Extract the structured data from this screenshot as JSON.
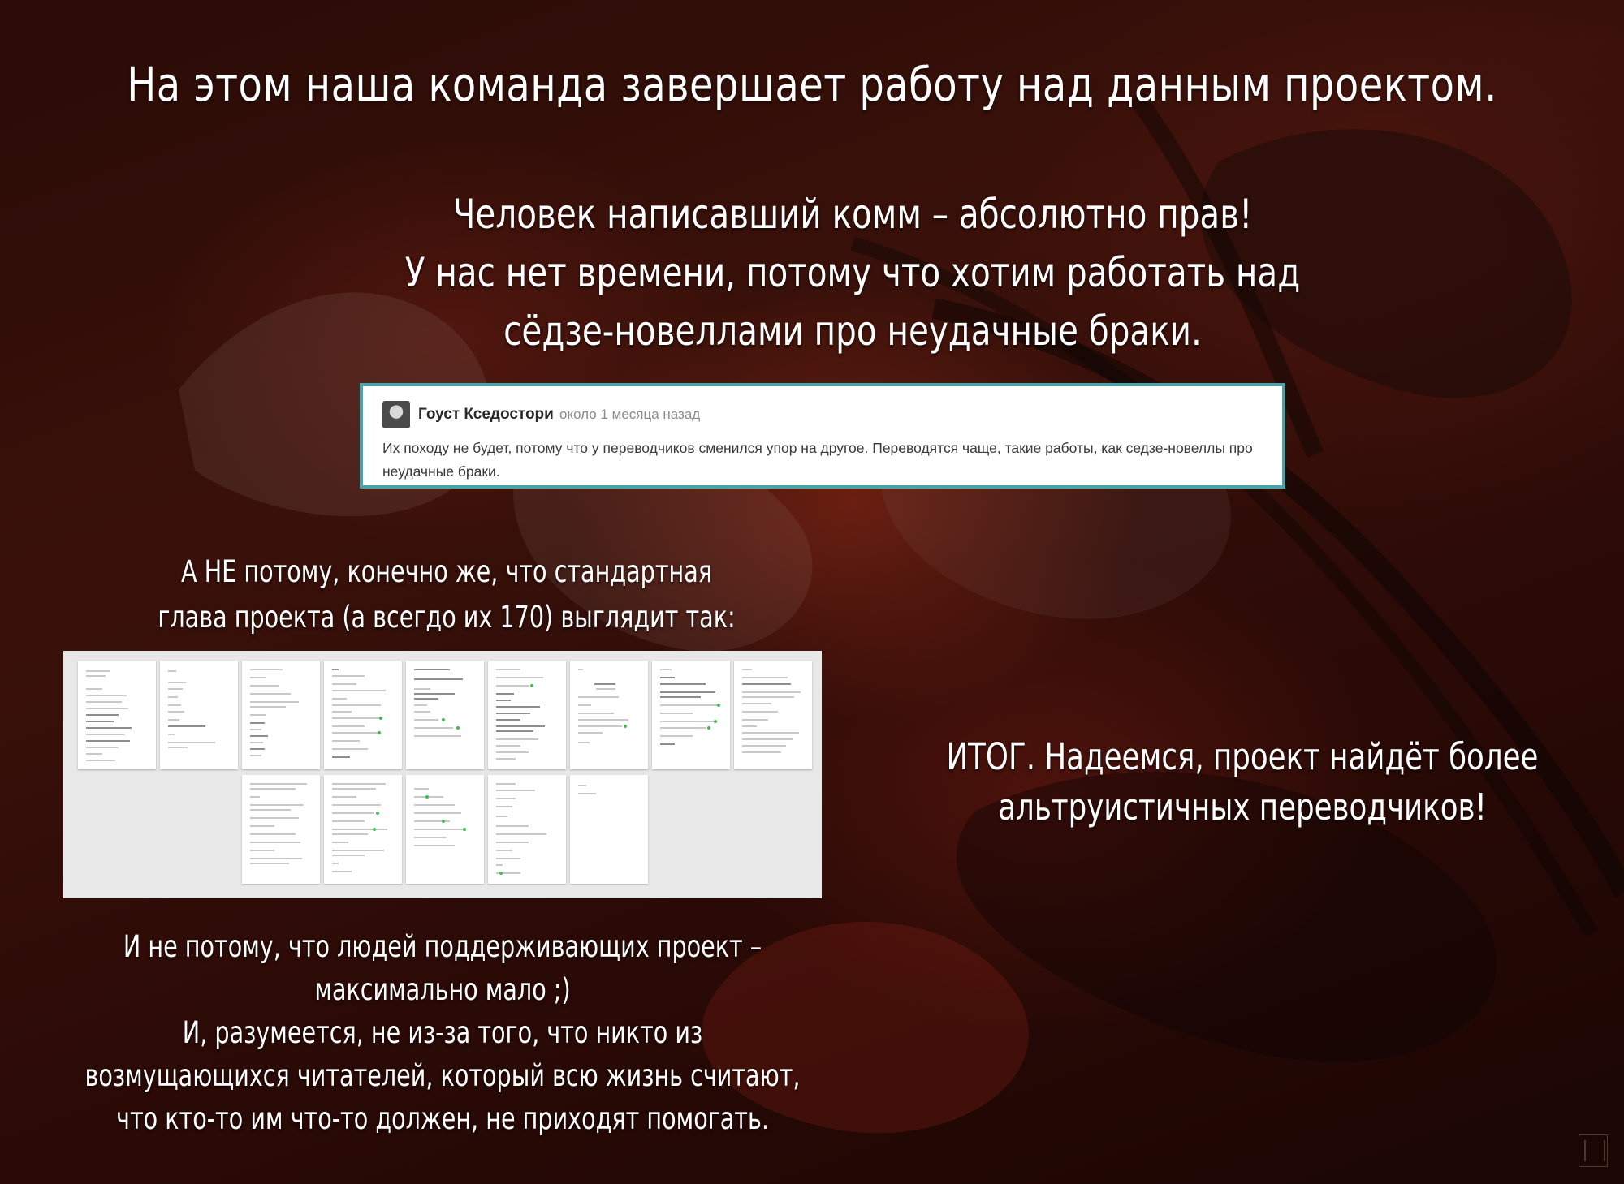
{
  "headline": "На этом наша команда завершает работу над данным проектом.",
  "statement": {
    "lines": "Человек написавший комм – абсолютно прав!\nУ нас нет времени, потому что хотим работать над\nсёдзе-новеллами про неудачные браки."
  },
  "comment": {
    "author": "Гоуст Кседостори",
    "time": "около 1 месяца назад",
    "text": "Их походу не будет, потому что у переводчиков сменился упор на другое. Переводятся чаще, такие работы, как седзе-новеллы про неудачные браки.",
    "avatar_icon": "avatar-icon",
    "border_color": "#4aa3a8"
  },
  "not_because": "А НЕ потому, конечно же, что стандартная\nглава проекта (а всегдо их 170) выглядит так:",
  "conclusion": "ИТОГ. Надеемся, проект найдёт более\nальтруистичных переводчиков!",
  "bottom_text": "И не потому, что людей поддерживающих проект –\nмаксимально мало ;)\nИ, разумеется, не из-за того, что никто из\nвозмущающихся читателей, который всю жизнь считают,\nчто кто-то им что-то должен, не приходят помогать.",
  "document_preview": {
    "description_icon": "document-pages-icon",
    "rows": [
      {
        "pages": 9
      },
      {
        "pages": 5
      }
    ]
  },
  "colors": {
    "background": "#2a0b06",
    "text": "#ffffff",
    "comment_link_green": "#3fbf4f"
  }
}
